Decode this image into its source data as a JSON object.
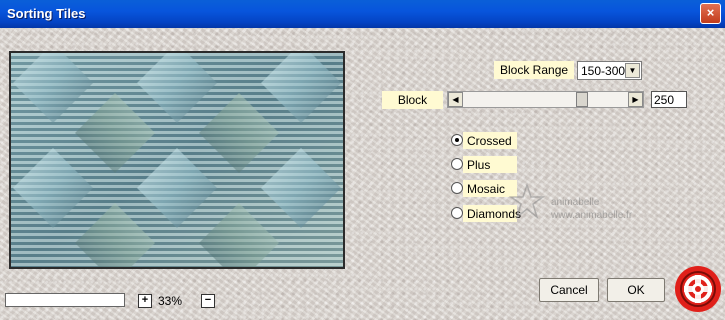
{
  "window": {
    "title": "Sorting Tiles",
    "close_glyph": "×"
  },
  "block_range": {
    "label": "Block Range",
    "value": "150-300"
  },
  "block": {
    "label": "Block",
    "value": "250",
    "level_percent": 74
  },
  "modes": [
    {
      "label": "Crossed",
      "selected": true
    },
    {
      "label": "Plus",
      "selected": false
    },
    {
      "label": "Mosaic",
      "selected": false
    },
    {
      "label": "Diamonds",
      "selected": false
    }
  ],
  "watermark": {
    "line1": "animabelle",
    "line2": "www.animabelle.fr"
  },
  "zoom": {
    "value": "33%",
    "plus": "+",
    "minus": "−"
  },
  "buttons": {
    "cancel": "Cancel",
    "ok": "OK"
  },
  "colors": {
    "titlebar": "#0855dc",
    "label_bg": "#fffad2",
    "help_red": "#e0201a"
  },
  "icons": {
    "help": "help-lifebuoy-icon",
    "radio": "radio-icon"
  }
}
